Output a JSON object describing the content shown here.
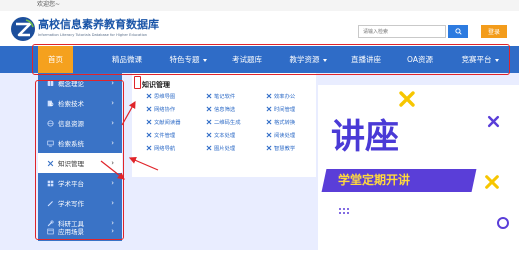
{
  "topbar": {
    "welcome": "欢迎您~"
  },
  "header": {
    "logo_title": "高校信息素养教育数据库",
    "logo_subtitle": "Information Literacy Tutorials Database for Higher Education",
    "search_placeholder": "请输入检索",
    "search_icon": "search-icon",
    "login_label": "登录"
  },
  "nav": {
    "items": [
      {
        "label": "首页",
        "active": true,
        "has_caret": false
      },
      {
        "label": "精品微课",
        "active": false,
        "has_caret": false
      },
      {
        "label": "特色专题",
        "active": false,
        "has_caret": true
      },
      {
        "label": "考试题库",
        "active": false,
        "has_caret": false
      },
      {
        "label": "教学资源",
        "active": false,
        "has_caret": true
      },
      {
        "label": "直播讲座",
        "active": false,
        "has_caret": false
      },
      {
        "label": "OA资源",
        "active": false,
        "has_caret": false
      },
      {
        "label": "竞赛平台",
        "active": false,
        "has_caret": true
      }
    ],
    "active_color": "#f5a11e",
    "bar_color": "#2f6cc7"
  },
  "menu": {
    "items": [
      {
        "label": "概念理论",
        "icon": "book-icon",
        "active": false
      },
      {
        "label": "检索技术",
        "icon": "search-doc-icon",
        "active": false
      },
      {
        "label": "信息资源",
        "icon": "globe-icon",
        "active": false
      },
      {
        "label": "检索系统",
        "icon": "monitor-icon",
        "active": false
      },
      {
        "label": "知识管理",
        "icon": "tools-icon",
        "active": true
      },
      {
        "label": "学术平台",
        "icon": "grid-icon",
        "active": false
      },
      {
        "label": "学术写作",
        "icon": "pen-icon",
        "active": false
      },
      {
        "label": "科研工具",
        "icon": "wrench-icon",
        "active": false
      },
      {
        "label": "应用场景",
        "icon": "layout-icon",
        "active": false
      }
    ],
    "chevron": "›"
  },
  "submenu": {
    "title": "知识管理",
    "items": [
      "思维导图",
      "笔记软件",
      "效率办公",
      "网络协作",
      "信息筛选",
      "时间管理",
      "文献阅读器",
      "二维码生成",
      "格式转换",
      "文件管理",
      "文本处理",
      "阅读处理",
      "网络导航",
      "图片处理",
      "智慧教学"
    ],
    "item_icon": "tools-icon"
  },
  "banner": {
    "headline": "讲座",
    "subline": "学堂定期开讲",
    "accent_color": "#4a3ad6",
    "x_color": "#f7c600"
  },
  "annotations": {
    "box_color": "#e0242a"
  }
}
